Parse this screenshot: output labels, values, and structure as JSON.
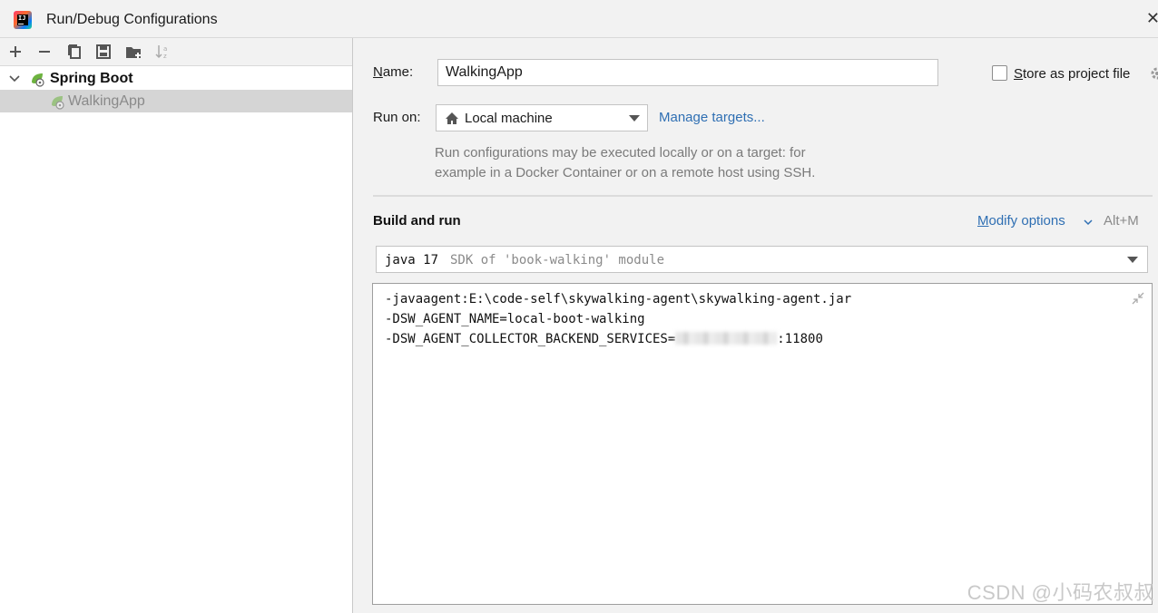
{
  "window": {
    "title": "Run/Debug Configurations"
  },
  "toolbar": {
    "icons": [
      "add-icon",
      "remove-icon",
      "copy-icon",
      "save-icon",
      "new-folder-icon",
      "sort-icon"
    ]
  },
  "tree": {
    "group_label": "Spring Boot",
    "item_label": "WalkingApp"
  },
  "form": {
    "name_label": "Name:",
    "name_value": "WalkingApp",
    "store_label": "Store as project file",
    "store_checked": false,
    "run_on_label": "Run on:",
    "run_on_value": "Local machine",
    "manage_targets": "Manage targets...",
    "hint_line1": "Run configurations may be executed locally or on a target: for",
    "hint_line2": "example in a Docker Container or on a remote host using SSH."
  },
  "build_run": {
    "title": "Build and run",
    "modify_options": "Modify options",
    "shortcut": "Alt+M",
    "sdk_version": "java 17",
    "sdk_detail": "SDK of 'book-walking' module",
    "vm_line1": "-javaagent:E:\\code-self\\skywalking-agent\\skywalking-agent.jar",
    "vm_line2": "-DSW_AGENT_NAME=local-boot-walking",
    "vm_line3_prefix": "-DSW_AGENT_COLLECTOR_BACKEND_SERVICES=",
    "vm_line3_suffix": ":11800"
  },
  "watermark": "CSDN @小码农叔叔",
  "colors": {
    "link": "#2f6fb3",
    "selection": "#d5d5d5",
    "spring_green": "#6db33f"
  }
}
